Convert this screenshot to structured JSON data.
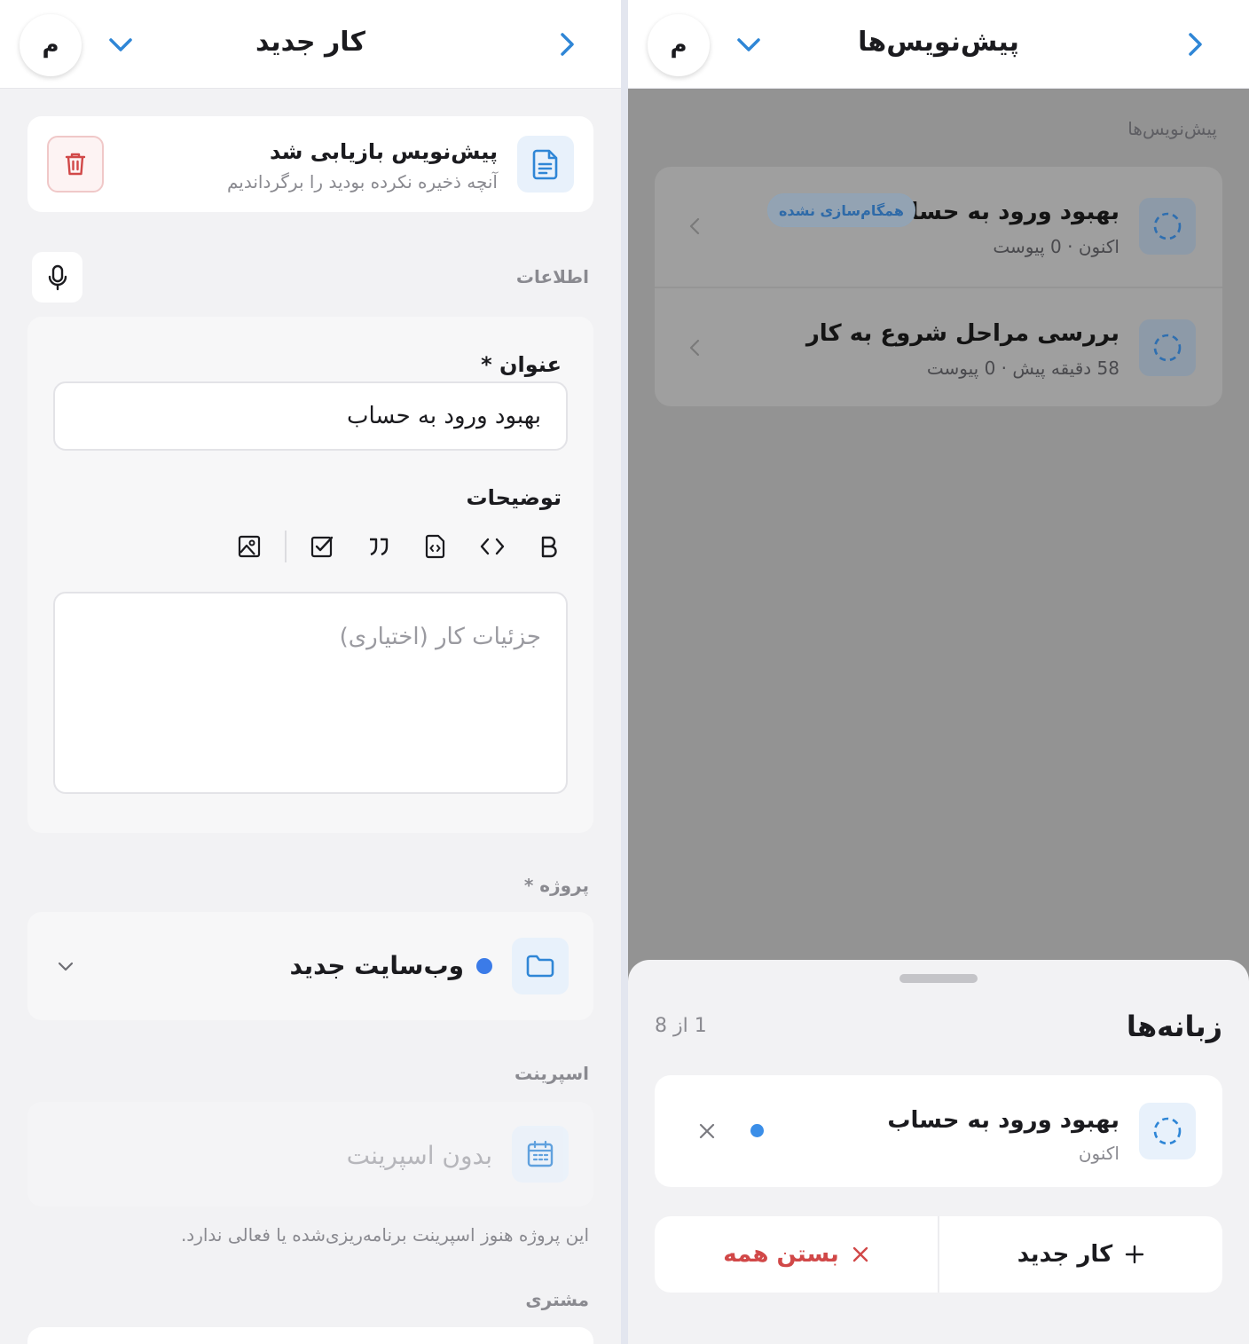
{
  "left": {
    "header": {
      "title": "کار جدید",
      "avatar": "م"
    },
    "draft": {
      "title": "پیش‌نویس بازیابی شد",
      "subtitle": "آنچه ذخیره نکرده بودید را برگرداندیم",
      "icon": "document-icon",
      "delete_icon": "trash-icon"
    },
    "info_label": "اطلاعات",
    "form": {
      "title_label": "عنوان *",
      "title_value": "بهبود ورود به حساب",
      "description_label": "توضیحات",
      "description_placeholder": "جزئیات کار (اختیاری)",
      "toolbar": [
        "bold-icon",
        "code-icon",
        "code-file-icon",
        "quote-icon",
        "checkbox-icon",
        "image-icon"
      ]
    },
    "project": {
      "label": "پروژه *",
      "value": "وب‌سایت جدید",
      "dot_color": "#3b7be8"
    },
    "sprint": {
      "label": "اسپرینت",
      "value": "بدون اسپرینت",
      "note": "این پروژه هنوز اسپرینت برنامه‌ریزی‌شده یا فعالی ندارد."
    },
    "customer": {
      "label": "مشتری"
    }
  },
  "right": {
    "header": {
      "title": "پیش‌نویس‌ها",
      "avatar": "م"
    },
    "list_label": "پیش‌نویس‌ها",
    "drafts": [
      {
        "title": "بهبود ورود به حساب",
        "subtitle": "اکنون · 0 پیوست",
        "badge": "همگام‌سازی نشده"
      },
      {
        "title": "بررسی مراحل شروع به کار",
        "subtitle": "58 دقیقه پیش · 0 پیوست",
        "badge": ""
      }
    ],
    "sheet": {
      "title": "زبانه‌ها",
      "count": "1 از 8",
      "tab": {
        "title": "بهبود ورود به حساب",
        "subtitle": "اکنون"
      },
      "new_task_label": "کار جدید",
      "close_all_label": "بستن همه"
    }
  },
  "colors": {
    "accent": "#2f86d6",
    "danger": "#d14848",
    "dot": "#3b7be8"
  }
}
